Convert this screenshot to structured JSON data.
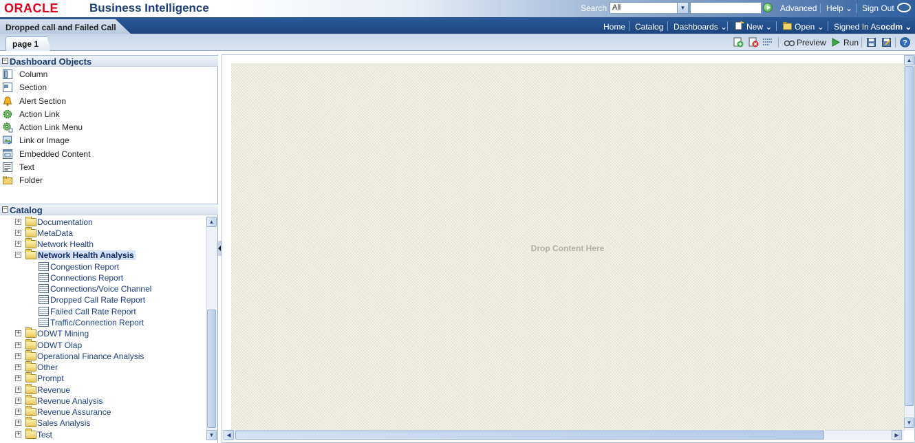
{
  "header": {
    "logo": "ORACLE",
    "app_title": "Business Intelligence",
    "search_label": "Search",
    "search_scope": "All",
    "search_value": "",
    "advanced": "Advanced",
    "help": "Help",
    "sign_out": "Sign Out"
  },
  "nav": {
    "dashboard_title": "Dropped call and Failed Call",
    "home": "Home",
    "catalog": "Catalog",
    "dashboards": "Dashboards",
    "new": "New",
    "open": "Open",
    "signed_in_as": "Signed In As",
    "user": "ocdm"
  },
  "tabs": {
    "page_tab": "page 1"
  },
  "toolbar": {
    "preview": "Preview",
    "run": "Run"
  },
  "dashboard_objects": {
    "title": "Dashboard Objects",
    "items": [
      {
        "label": "Column",
        "icon": "column-icon"
      },
      {
        "label": "Section",
        "icon": "section-icon"
      },
      {
        "label": "Alert Section",
        "icon": "bell-icon"
      },
      {
        "label": "Action Link",
        "icon": "gear-icon"
      },
      {
        "label": "Action Link Menu",
        "icon": "gear-menu-icon"
      },
      {
        "label": "Link or Image",
        "icon": "image-link-icon"
      },
      {
        "label": "Embedded Content",
        "icon": "embedded-content-icon"
      },
      {
        "label": "Text",
        "icon": "text-icon"
      },
      {
        "label": "Folder",
        "icon": "folder-icon"
      }
    ]
  },
  "catalog": {
    "title": "Catalog",
    "items": [
      {
        "label": "Documentation"
      },
      {
        "label": "MetaData"
      },
      {
        "label": "Network Health"
      },
      {
        "label": "Network Health Analysis",
        "expanded": true,
        "selected": true
      },
      {
        "label": "Congestion Report",
        "report": true
      },
      {
        "label": "Connections Report",
        "report": true
      },
      {
        "label": "Connections/Voice Channel",
        "report": true
      },
      {
        "label": "Dropped Call Rate Report",
        "report": true
      },
      {
        "label": "Failed Call Rate Report",
        "report": true
      },
      {
        "label": "Traffic/Connection Report",
        "report": true
      },
      {
        "label": "ODWT Mining"
      },
      {
        "label": "ODWT Olap"
      },
      {
        "label": "Operational Finance Analysis"
      },
      {
        "label": "Other"
      },
      {
        "label": "Prompt"
      },
      {
        "label": "Revenue"
      },
      {
        "label": "Revenue Analysis"
      },
      {
        "label": "Revenue Assurance"
      },
      {
        "label": "Sales Analysis"
      },
      {
        "label": "Test"
      }
    ]
  },
  "canvas": {
    "drop_text": "Drop Content Here"
  },
  "colors": {
    "oracle_red": "#e0001b",
    "brand_blue": "#1a3f7a",
    "link_blue": "#1e3f82"
  }
}
